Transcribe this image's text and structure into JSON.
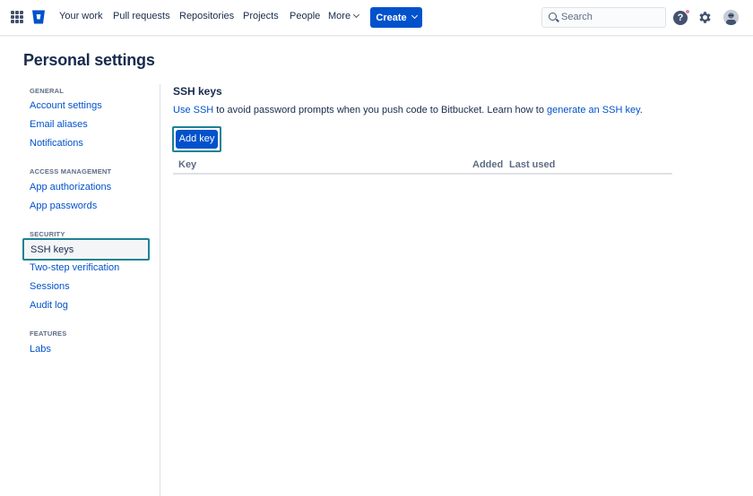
{
  "nav": {
    "items": [
      "Your work",
      "Pull requests",
      "Repositories",
      "Projects",
      "People"
    ],
    "more_label": "More",
    "create_label": "Create",
    "search_placeholder": "Search",
    "help_glyph": "?",
    "icons": [
      "app-switcher-icon",
      "bitbucket-logo",
      "search-icon",
      "help-icon",
      "gear-icon",
      "avatar"
    ],
    "brand_color": "#0052cc"
  },
  "page": {
    "title": "Personal settings"
  },
  "sidebar": {
    "groups": [
      {
        "heading": "GENERAL",
        "items": [
          "Account settings",
          "Email aliases",
          "Notifications"
        ]
      },
      {
        "heading": "ACCESS MANAGEMENT",
        "items": [
          "App authorizations",
          "App passwords"
        ]
      },
      {
        "heading": "SECURITY",
        "items": [
          "SSH keys",
          "Two-step verification",
          "Sessions",
          "Audit log"
        ]
      },
      {
        "heading": "FEATURES",
        "items": [
          "Labs"
        ]
      }
    ],
    "active_item": "SSH keys",
    "focus_color": "#1d8293"
  },
  "main": {
    "title": "SSH keys",
    "desc_link1": "Use SSH",
    "desc_text1": " to avoid password prompts when you push code to Bitbucket. Learn how to ",
    "desc_link2": "generate an SSH key",
    "desc_text2": ".",
    "add_key_label": "Add key",
    "table": {
      "columns": [
        "Key",
        "Added",
        "Last used"
      ],
      "rows": []
    }
  }
}
